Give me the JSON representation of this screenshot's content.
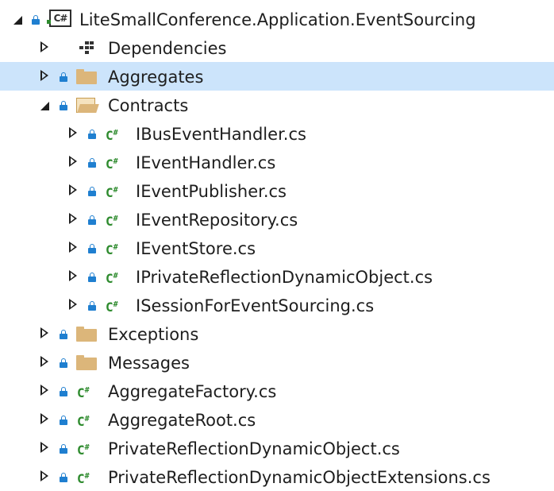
{
  "tree": {
    "root": {
      "label": "LiteSmallConference.Application.EventSourcing",
      "icon": "csharp-project-icon",
      "expanded": true
    },
    "items": [
      {
        "label": "Dependencies",
        "icon": "dependencies-icon",
        "expanded": false
      },
      {
        "label": "Aggregates",
        "icon": "folder-icon",
        "expanded": false,
        "selected": true
      },
      {
        "label": "Contracts",
        "icon": "folder-open-icon",
        "expanded": true
      },
      {
        "label": "IBusEventHandler.cs",
        "icon": "csharp-file-icon",
        "expanded": false
      },
      {
        "label": "IEventHandler.cs",
        "icon": "csharp-file-icon",
        "expanded": false
      },
      {
        "label": "IEventPublisher.cs",
        "icon": "csharp-file-icon",
        "expanded": false
      },
      {
        "label": "IEventRepository.cs",
        "icon": "csharp-file-icon",
        "expanded": false
      },
      {
        "label": "IEventStore.cs",
        "icon": "csharp-file-icon",
        "expanded": false
      },
      {
        "label": "IPrivateReflectionDynamicObject.cs",
        "icon": "csharp-file-icon",
        "expanded": false
      },
      {
        "label": "ISessionForEventSourcing.cs",
        "icon": "csharp-file-icon",
        "expanded": false
      },
      {
        "label": "Exceptions",
        "icon": "folder-icon",
        "expanded": false
      },
      {
        "label": "Messages",
        "icon": "folder-icon",
        "expanded": false
      },
      {
        "label": "AggregateFactory.cs",
        "icon": "csharp-file-icon",
        "expanded": false
      },
      {
        "label": "AggregateRoot.cs",
        "icon": "csharp-file-icon",
        "expanded": false
      },
      {
        "label": "PrivateReflectionDynamicObject.cs",
        "icon": "csharp-file-icon",
        "expanded": false
      },
      {
        "label": "PrivateReflectionDynamicObjectExtensions.cs",
        "icon": "csharp-file-icon",
        "expanded": false
      }
    ],
    "cs_glyph": "C",
    "cs_sup": "#",
    "project_glyph": "C#"
  },
  "colors": {
    "selection": "#cce4fb",
    "lock": "#1f7fd0",
    "csharp": "#2e8b2e",
    "folder": "#dcb67a"
  }
}
